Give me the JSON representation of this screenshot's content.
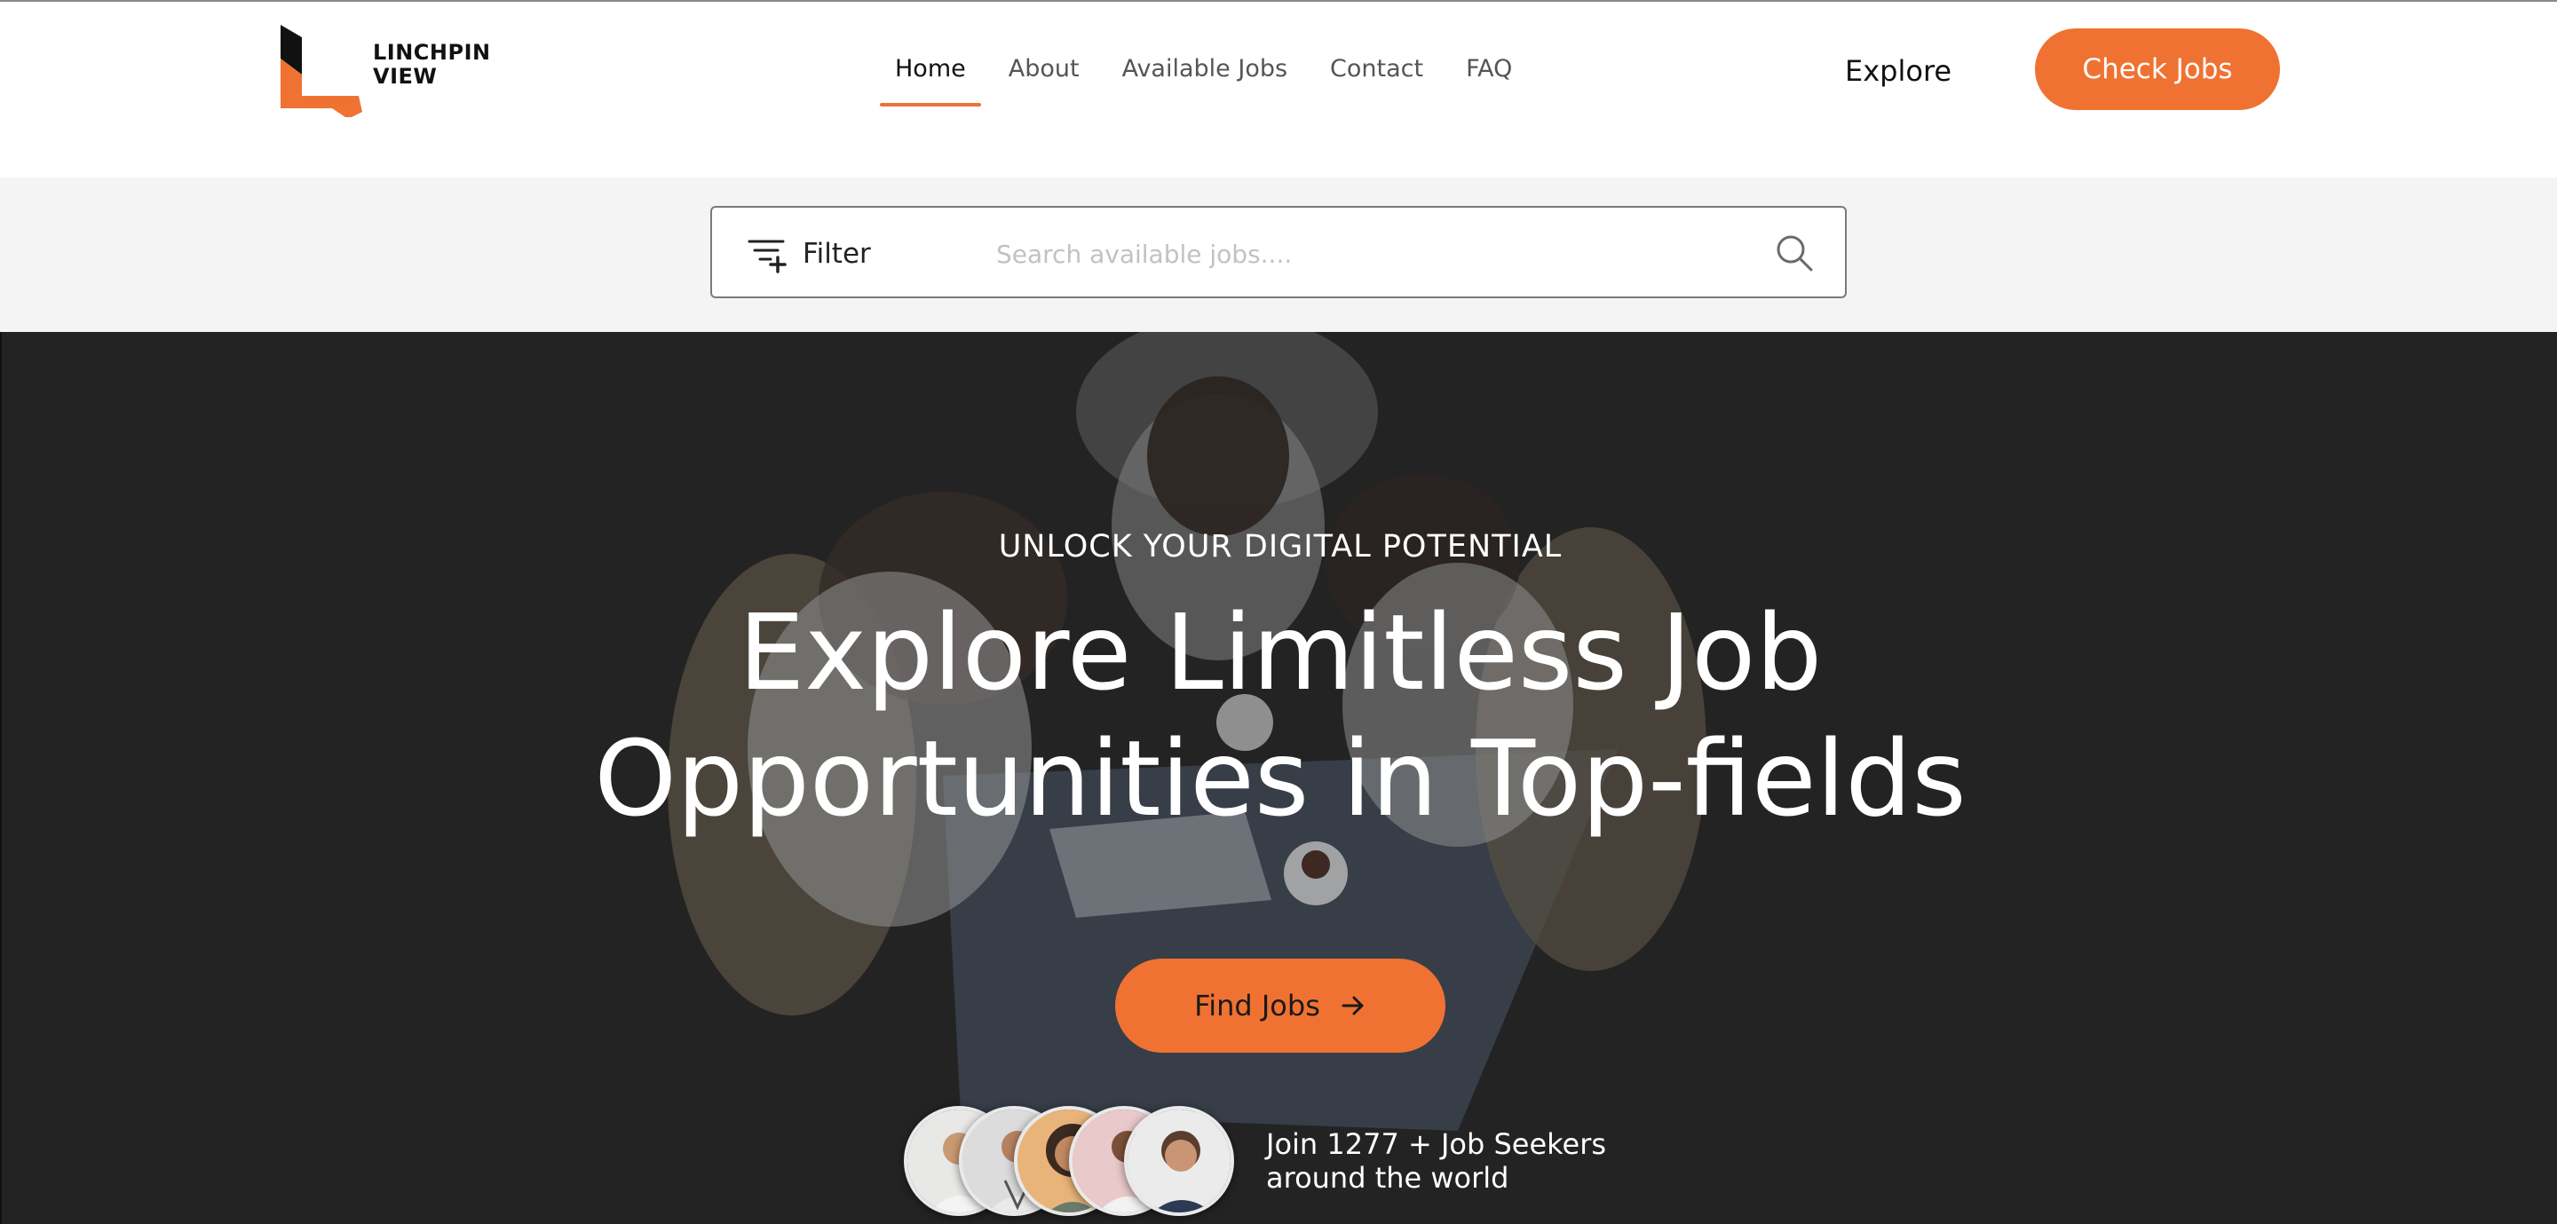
{
  "brand": {
    "name_line1": "LINCHPIN",
    "name_line2": "VIEW",
    "accent_color": "#f07232"
  },
  "nav": {
    "items": [
      {
        "label": "Home",
        "active": true
      },
      {
        "label": "About",
        "active": false
      },
      {
        "label": "Available Jobs",
        "active": false
      },
      {
        "label": "Contact",
        "active": false
      },
      {
        "label": "FAQ",
        "active": false
      }
    ],
    "explore_label": "Explore",
    "cta_label": "Check Jobs"
  },
  "search": {
    "filter_label": "Filter",
    "placeholder": "Search available jobs....",
    "value": "",
    "filter_icon": "filter-add-icon",
    "search_icon": "search-icon"
  },
  "hero": {
    "eyebrow": "UNLOCK YOUR DIGITAL POTENTIAL",
    "headline_line1": "Explore Limitless Job",
    "headline_line2": "Opportunities in Top-fields",
    "cta_label": "Find Jobs",
    "cta_icon": "arrow-right-icon",
    "seekers_line1": "Join 1277 + Job Seekers",
    "seekers_line2": "around the world",
    "background_color": "#242424"
  }
}
